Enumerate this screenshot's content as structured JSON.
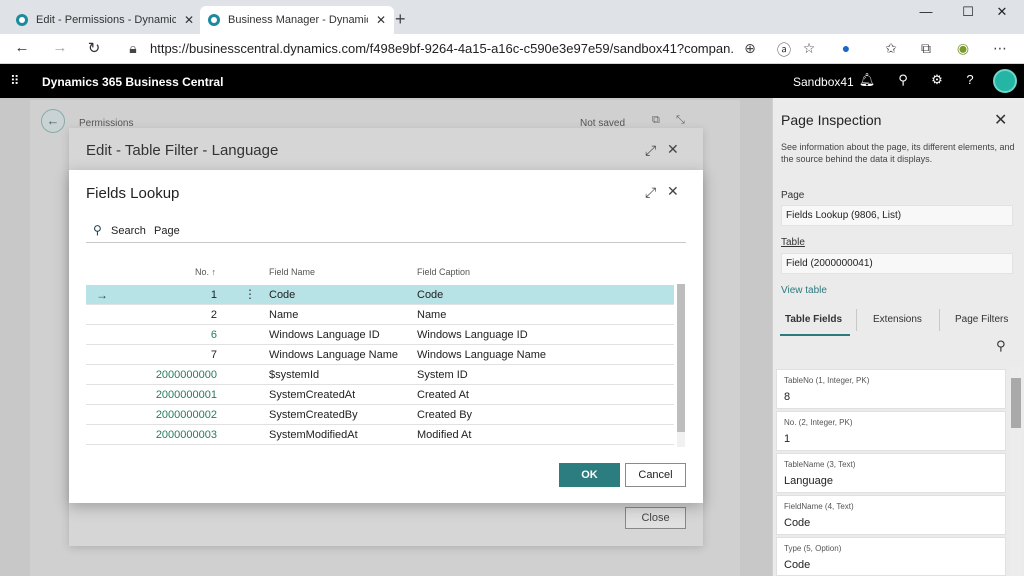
{
  "browser": {
    "tabs": [
      {
        "title": "Edit - Permissions - Dynamics 36",
        "close": "✕"
      },
      {
        "title": "Business Manager - Dynamics 36",
        "close": "✕"
      }
    ],
    "new_tab": "+",
    "window_controls": {
      "minimize": "—",
      "maximize": "☐",
      "close": "✕"
    },
    "url": "https://businesscentral.dynamics.com/f498e9bf-9264-4a15-a16c-c590e3e97e59/sandbox41?compan..."
  },
  "header": {
    "app_title": "Dynamics 365 Business Central",
    "environment": "Sandbox41"
  },
  "background": {
    "breadcrumb": "Permissions",
    "status": "Not saved",
    "close_button": "Close"
  },
  "edit_dialog": {
    "title": "Edit - Table Filter - Language"
  },
  "lookup": {
    "title": "Fields Lookup",
    "toolbar": {
      "search": "Search",
      "page": "Page"
    },
    "columns": {
      "no": "No. ↑",
      "field_name": "Field Name",
      "field_caption": "Field Caption"
    },
    "rows": [
      {
        "no": "1",
        "field_name": "Code",
        "field_caption": "Code"
      },
      {
        "no": "2",
        "field_name": "Name",
        "field_caption": "Name"
      },
      {
        "no": "6",
        "field_name": "Windows Language ID",
        "field_caption": "Windows Language ID"
      },
      {
        "no": "7",
        "field_name": "Windows Language Name",
        "field_caption": "Windows Language Name"
      },
      {
        "no": "2000000000",
        "field_name": "$systemId",
        "field_caption": "System ID"
      },
      {
        "no": "2000000001",
        "field_name": "SystemCreatedAt",
        "field_caption": "Created At"
      },
      {
        "no": "2000000002",
        "field_name": "SystemCreatedBy",
        "field_caption": "Created By"
      },
      {
        "no": "2000000003",
        "field_name": "SystemModifiedAt",
        "field_caption": "Modified At"
      }
    ],
    "ok_label": "OK",
    "cancel_label": "Cancel"
  },
  "inspection": {
    "title": "Page Inspection",
    "description": "See information about the page, its different elements, and the source behind the data it displays.",
    "page_label": "Page",
    "page_value": "Fields Lookup (9806, List)",
    "table_label": "Table",
    "table_value": "Field (2000000041)",
    "view_table": "View table",
    "tabs": [
      "Table Fields",
      "Extensions",
      "Page Filters"
    ],
    "fields": [
      {
        "label": "TableNo (1, Integer, PK)",
        "value": "8"
      },
      {
        "label": "No. (2, Integer, PK)",
        "value": "1"
      },
      {
        "label": "TableName (3, Text)",
        "value": "Language"
      },
      {
        "label": "FieldName (4, Text)",
        "value": "Code"
      },
      {
        "label": "Type (5, Option)",
        "value": "Code"
      }
    ]
  },
  "colors": {
    "accent": "#2b7d80",
    "selected_row": "#b7e3e7",
    "header_bg": "#000000"
  }
}
